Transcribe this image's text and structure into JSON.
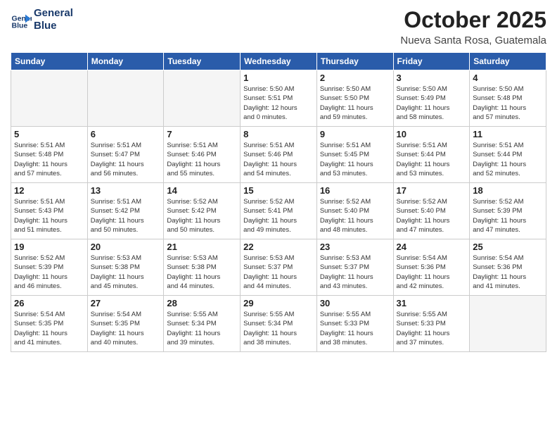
{
  "header": {
    "logo_line1": "General",
    "logo_line2": "Blue",
    "month": "October 2025",
    "location": "Nueva Santa Rosa, Guatemala"
  },
  "weekdays": [
    "Sunday",
    "Monday",
    "Tuesday",
    "Wednesday",
    "Thursday",
    "Friday",
    "Saturday"
  ],
  "weeks": [
    [
      {
        "day": "",
        "info": ""
      },
      {
        "day": "",
        "info": ""
      },
      {
        "day": "",
        "info": ""
      },
      {
        "day": "1",
        "info": "Sunrise: 5:50 AM\nSunset: 5:51 PM\nDaylight: 12 hours\nand 0 minutes."
      },
      {
        "day": "2",
        "info": "Sunrise: 5:50 AM\nSunset: 5:50 PM\nDaylight: 11 hours\nand 59 minutes."
      },
      {
        "day": "3",
        "info": "Sunrise: 5:50 AM\nSunset: 5:49 PM\nDaylight: 11 hours\nand 58 minutes."
      },
      {
        "day": "4",
        "info": "Sunrise: 5:50 AM\nSunset: 5:48 PM\nDaylight: 11 hours\nand 57 minutes."
      }
    ],
    [
      {
        "day": "5",
        "info": "Sunrise: 5:51 AM\nSunset: 5:48 PM\nDaylight: 11 hours\nand 57 minutes."
      },
      {
        "day": "6",
        "info": "Sunrise: 5:51 AM\nSunset: 5:47 PM\nDaylight: 11 hours\nand 56 minutes."
      },
      {
        "day": "7",
        "info": "Sunrise: 5:51 AM\nSunset: 5:46 PM\nDaylight: 11 hours\nand 55 minutes."
      },
      {
        "day": "8",
        "info": "Sunrise: 5:51 AM\nSunset: 5:46 PM\nDaylight: 11 hours\nand 54 minutes."
      },
      {
        "day": "9",
        "info": "Sunrise: 5:51 AM\nSunset: 5:45 PM\nDaylight: 11 hours\nand 53 minutes."
      },
      {
        "day": "10",
        "info": "Sunrise: 5:51 AM\nSunset: 5:44 PM\nDaylight: 11 hours\nand 53 minutes."
      },
      {
        "day": "11",
        "info": "Sunrise: 5:51 AM\nSunset: 5:44 PM\nDaylight: 11 hours\nand 52 minutes."
      }
    ],
    [
      {
        "day": "12",
        "info": "Sunrise: 5:51 AM\nSunset: 5:43 PM\nDaylight: 11 hours\nand 51 minutes."
      },
      {
        "day": "13",
        "info": "Sunrise: 5:51 AM\nSunset: 5:42 PM\nDaylight: 11 hours\nand 50 minutes."
      },
      {
        "day": "14",
        "info": "Sunrise: 5:52 AM\nSunset: 5:42 PM\nDaylight: 11 hours\nand 50 minutes."
      },
      {
        "day": "15",
        "info": "Sunrise: 5:52 AM\nSunset: 5:41 PM\nDaylight: 11 hours\nand 49 minutes."
      },
      {
        "day": "16",
        "info": "Sunrise: 5:52 AM\nSunset: 5:40 PM\nDaylight: 11 hours\nand 48 minutes."
      },
      {
        "day": "17",
        "info": "Sunrise: 5:52 AM\nSunset: 5:40 PM\nDaylight: 11 hours\nand 47 minutes."
      },
      {
        "day": "18",
        "info": "Sunrise: 5:52 AM\nSunset: 5:39 PM\nDaylight: 11 hours\nand 47 minutes."
      }
    ],
    [
      {
        "day": "19",
        "info": "Sunrise: 5:52 AM\nSunset: 5:39 PM\nDaylight: 11 hours\nand 46 minutes."
      },
      {
        "day": "20",
        "info": "Sunrise: 5:53 AM\nSunset: 5:38 PM\nDaylight: 11 hours\nand 45 minutes."
      },
      {
        "day": "21",
        "info": "Sunrise: 5:53 AM\nSunset: 5:38 PM\nDaylight: 11 hours\nand 44 minutes."
      },
      {
        "day": "22",
        "info": "Sunrise: 5:53 AM\nSunset: 5:37 PM\nDaylight: 11 hours\nand 44 minutes."
      },
      {
        "day": "23",
        "info": "Sunrise: 5:53 AM\nSunset: 5:37 PM\nDaylight: 11 hours\nand 43 minutes."
      },
      {
        "day": "24",
        "info": "Sunrise: 5:54 AM\nSunset: 5:36 PM\nDaylight: 11 hours\nand 42 minutes."
      },
      {
        "day": "25",
        "info": "Sunrise: 5:54 AM\nSunset: 5:36 PM\nDaylight: 11 hours\nand 41 minutes."
      }
    ],
    [
      {
        "day": "26",
        "info": "Sunrise: 5:54 AM\nSunset: 5:35 PM\nDaylight: 11 hours\nand 41 minutes."
      },
      {
        "day": "27",
        "info": "Sunrise: 5:54 AM\nSunset: 5:35 PM\nDaylight: 11 hours\nand 40 minutes."
      },
      {
        "day": "28",
        "info": "Sunrise: 5:55 AM\nSunset: 5:34 PM\nDaylight: 11 hours\nand 39 minutes."
      },
      {
        "day": "29",
        "info": "Sunrise: 5:55 AM\nSunset: 5:34 PM\nDaylight: 11 hours\nand 38 minutes."
      },
      {
        "day": "30",
        "info": "Sunrise: 5:55 AM\nSunset: 5:33 PM\nDaylight: 11 hours\nand 38 minutes."
      },
      {
        "day": "31",
        "info": "Sunrise: 5:55 AM\nSunset: 5:33 PM\nDaylight: 11 hours\nand 37 minutes."
      },
      {
        "day": "",
        "info": ""
      }
    ]
  ]
}
